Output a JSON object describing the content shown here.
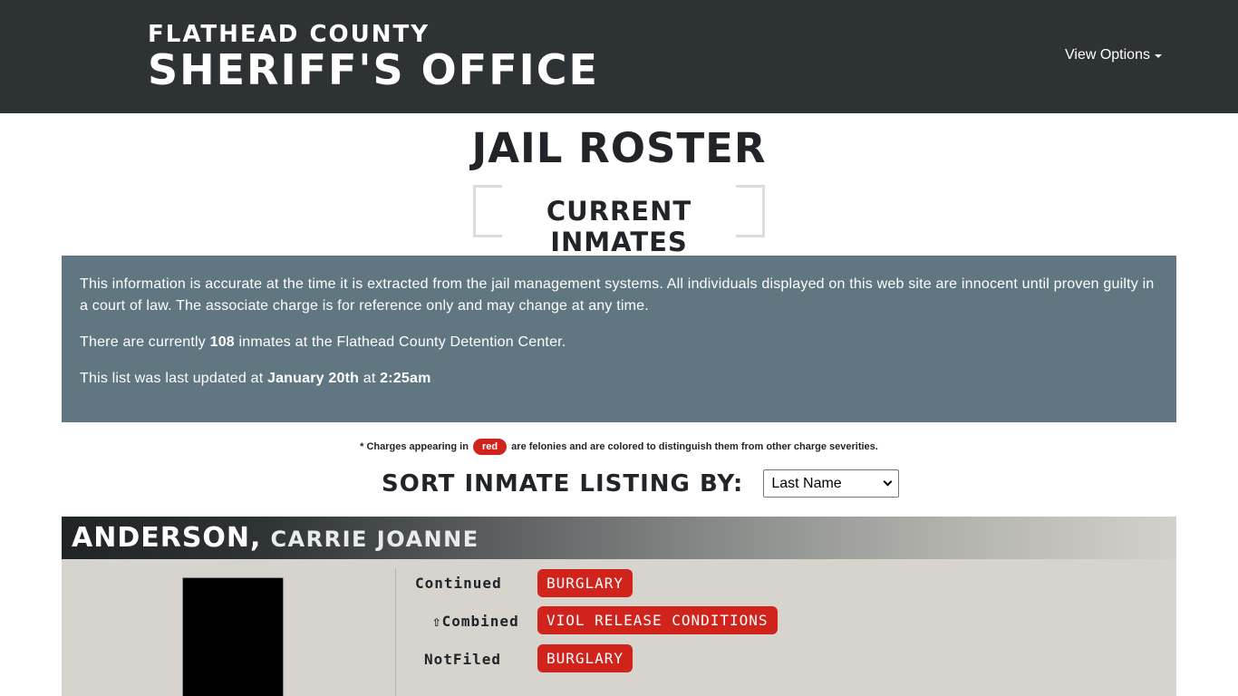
{
  "header": {
    "brand_line1": "FLATHEAD COUNTY",
    "brand_line2": "SHERIFF'S OFFICE",
    "view_options_label": "View Options"
  },
  "page": {
    "title": "JAIL ROSTER",
    "subtitle": "CURRENT INMATES"
  },
  "info": {
    "disclaimer": "This information is accurate at the time it is extracted from the jail management systems. All individuals displayed on this web site are innocent until proven guilty in a court of law. The associate charge is for reference only and may change at any time.",
    "count_prefix": "There are currently ",
    "count_value": "108",
    "count_suffix": " inmates at the Flathead County Detention Center.",
    "updated_prefix": "This list was last updated at ",
    "updated_date": "January 20th",
    "updated_mid": " at ",
    "updated_time": "2:25am"
  },
  "note": {
    "prefix": "* Charges appearing in ",
    "pill": "red",
    "suffix": " are felonies and are colored to distinguish them from other charge severities."
  },
  "sort": {
    "label": "SORT INMATE LISTING BY:",
    "selected": "Last Name"
  },
  "inmate": {
    "last_name": "ANDERSON,",
    "first_name": "CARRIE JOANNE",
    "charges": [
      {
        "status": "Continued",
        "charge": "BURGLARY"
      },
      {
        "status": "⇧Combined",
        "charge": "VIOL RELEASE CONDITIONS"
      },
      {
        "status": "NotFiled",
        "charge": "BURGLARY"
      }
    ]
  },
  "colors": {
    "topbar": "#2d3235",
    "info_panel": "#607680",
    "felony_red": "#d0231c",
    "card_body": "#d6d4cd"
  }
}
